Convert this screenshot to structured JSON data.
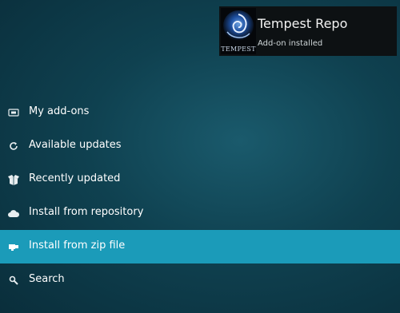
{
  "notification": {
    "title": "Tempest Repo",
    "subtitle": "Add-on installed",
    "thumbnail_logo_text": "TEMPEST",
    "icon": "tempest-logo"
  },
  "menu": {
    "items": [
      {
        "label": "My add-ons",
        "icon": "addons-box-icon",
        "selected": false
      },
      {
        "label": "Available updates",
        "icon": "refresh-icon",
        "selected": false
      },
      {
        "label": "Recently updated",
        "icon": "open-box-icon",
        "selected": false
      },
      {
        "label": "Install from repository",
        "icon": "cloud-icon",
        "selected": false
      },
      {
        "label": "Install from zip file",
        "icon": "zip-icon",
        "selected": true
      },
      {
        "label": "Search",
        "icon": "search-icon",
        "selected": false
      }
    ]
  },
  "colors": {
    "background": "#0f4150",
    "selected_row": "#1b9bb9",
    "notification_bg": "#0d1113"
  }
}
